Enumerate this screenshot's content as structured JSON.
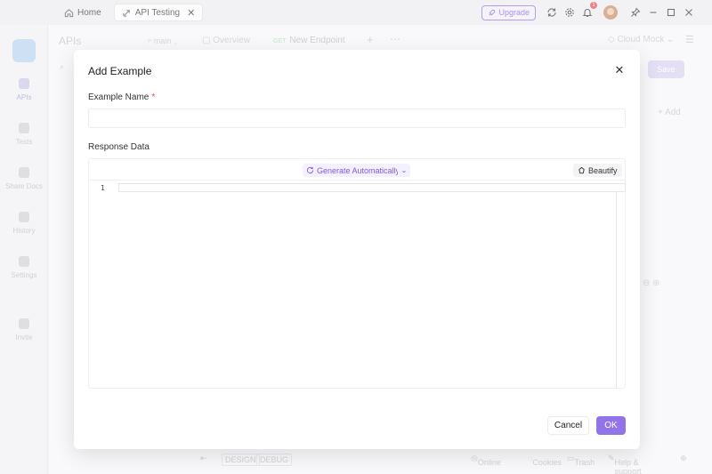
{
  "titlebar": {
    "tabs": [
      {
        "label": "Home",
        "icon": "home-icon"
      },
      {
        "label": "API Testing",
        "icon": "api-icon"
      }
    ],
    "upgrade_label": "Upgrade",
    "notification_count": "1"
  },
  "rail": {
    "items": [
      {
        "label": "APIs"
      },
      {
        "label": "Tests"
      },
      {
        "label": "Share Docs"
      },
      {
        "label": "History"
      },
      {
        "label": "Settings"
      },
      {
        "label": "Invite"
      }
    ]
  },
  "background": {
    "title": "APIs",
    "branch": "main",
    "overview_tab": "Overview",
    "endpoint_method": "GET",
    "endpoint_tab": "New Endpoint",
    "mock": "Cloud Mock",
    "save": "Save",
    "add": "Add"
  },
  "footer": {
    "design": "DESIGN",
    "debug": "DEBUG",
    "online": "Online",
    "cookies": "Cookies",
    "trash": "Trash",
    "help": "Help & support"
  },
  "modal": {
    "title": "Add Example",
    "name_label": "Example Name",
    "name_required": "*",
    "name_value": "",
    "response_label": "Response Data",
    "generate_label": "Generate Automatically",
    "beautify_label": "Beautify",
    "line_number": "1",
    "cancel_label": "Cancel",
    "ok_label": "OK"
  },
  "colors": {
    "accent": "#9373ea",
    "required": "#e5484d"
  }
}
